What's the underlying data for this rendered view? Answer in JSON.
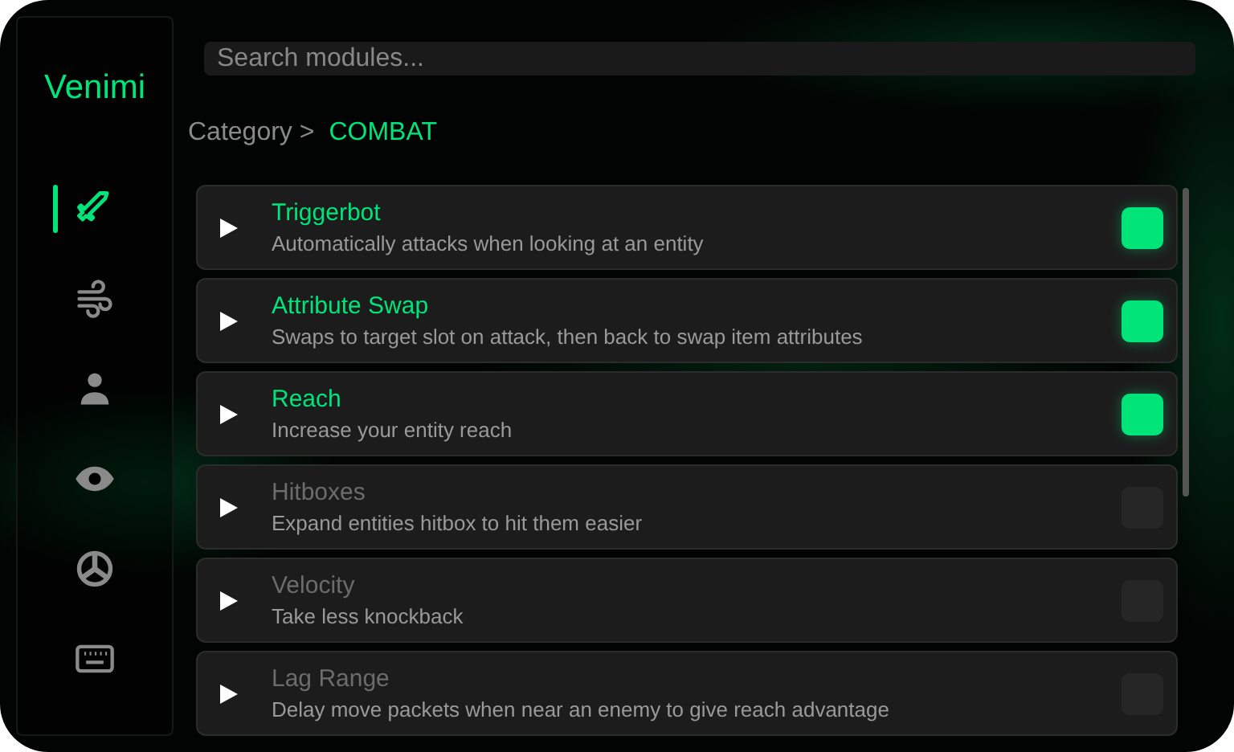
{
  "sidebar": {
    "logo": "Venimi",
    "categories": [
      {
        "selected": true
      },
      {
        "selected": false
      },
      {
        "selected": false
      },
      {
        "selected": false
      },
      {
        "selected": false
      },
      {
        "selected": false
      }
    ]
  },
  "search": {
    "placeholder": "Search modules..."
  },
  "breadcrumb": {
    "prefix": "Category >",
    "current": "COMBAT"
  },
  "modules": [
    {
      "name": "Triggerbot",
      "description": "Automatically attacks when looking at an entity",
      "enabled": true
    },
    {
      "name": "Attribute Swap",
      "description": "Swaps to target slot on attack, then back to swap item attributes",
      "enabled": true
    },
    {
      "name": "Reach",
      "description": "Increase your entity reach",
      "enabled": true
    },
    {
      "name": "Hitboxes",
      "description": "Expand entities hitbox to hit them easier",
      "enabled": false
    },
    {
      "name": "Velocity",
      "description": "Take less knockback",
      "enabled": false
    },
    {
      "name": "Lag Range",
      "description": "Delay move packets when near an enemy to give reach advantage",
      "enabled": false
    }
  ]
}
